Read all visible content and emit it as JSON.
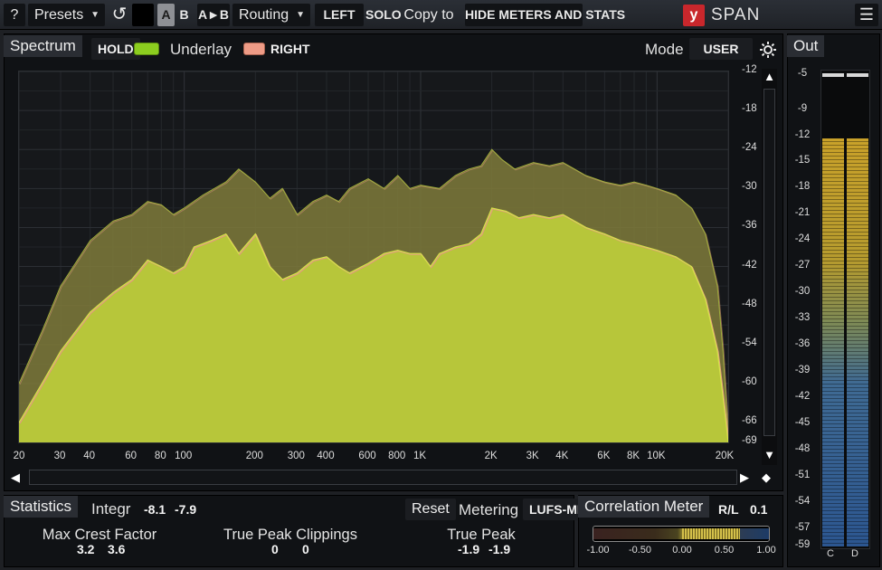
{
  "topbar": {
    "help": "?",
    "presets": "Presets",
    "presets_arrow": "▼",
    "undo_icon": "↺",
    "a": "A",
    "b": "B",
    "ab": "A►B",
    "routing": "Routing",
    "routing_arrow": "▼",
    "left": "LEFT",
    "solo": "SOLO",
    "copy_to": "Copy to",
    "hide": "HIDE METERS AND STATS",
    "logo_text": "SPAN",
    "menu_icon": "☰"
  },
  "spectrum": {
    "tab": "Spectrum",
    "hold": "HOLD",
    "underlay": "Underlay",
    "right": "RIGHT",
    "mode_label": "Mode",
    "mode_value": "USER",
    "db_labels": [
      "-12",
      "-18",
      "-24",
      "-30",
      "-36",
      "-42",
      "-48",
      "-54",
      "-60",
      "-66",
      "-69"
    ],
    "freq_labels": [
      "20",
      "30",
      "40",
      "60",
      "80",
      "100",
      "200",
      "300",
      "400",
      "600",
      "800",
      "1K",
      "2K",
      "3K",
      "4K",
      "6K",
      "8K",
      "10K",
      "20K"
    ],
    "colors": {
      "main": "#b7c63a",
      "underlay": "#7d7d3a",
      "right_outline": "#e39a80",
      "bg": "#15171a"
    }
  },
  "out": {
    "tab": "Out",
    "scale": [
      "-5",
      "-9",
      "-12",
      "-15",
      "-18",
      "-21",
      "-24",
      "-27",
      "-30",
      "-33",
      "-36",
      "-39",
      "-42",
      "-45",
      "-48",
      "-51",
      "-54",
      "-57",
      "-59"
    ],
    "channels": [
      "C",
      "D"
    ],
    "level_db": -9
  },
  "statistics": {
    "tab": "Statistics",
    "integr_label": "Integr",
    "integr_l": "-8.1",
    "integr_r": "-7.9",
    "reset": "Reset",
    "metering_label": "Metering",
    "metering_value": "LUFS-ML",
    "max_crest_label": "Max Crest Factor",
    "max_crest_l": "3.2",
    "max_crest_r": "3.6",
    "tp_clip_label": "True Peak Clippings",
    "tp_clip_l": "0",
    "tp_clip_r": "0",
    "tp_label": "True Peak",
    "tp_l": "-1.9",
    "tp_r": "-1.9"
  },
  "correlation": {
    "tab": "Correlation Meter",
    "mode": "R/L",
    "value": "0.1",
    "scale": [
      "-1.00",
      "-0.50",
      "0.00",
      "0.50",
      "1.00"
    ]
  }
}
